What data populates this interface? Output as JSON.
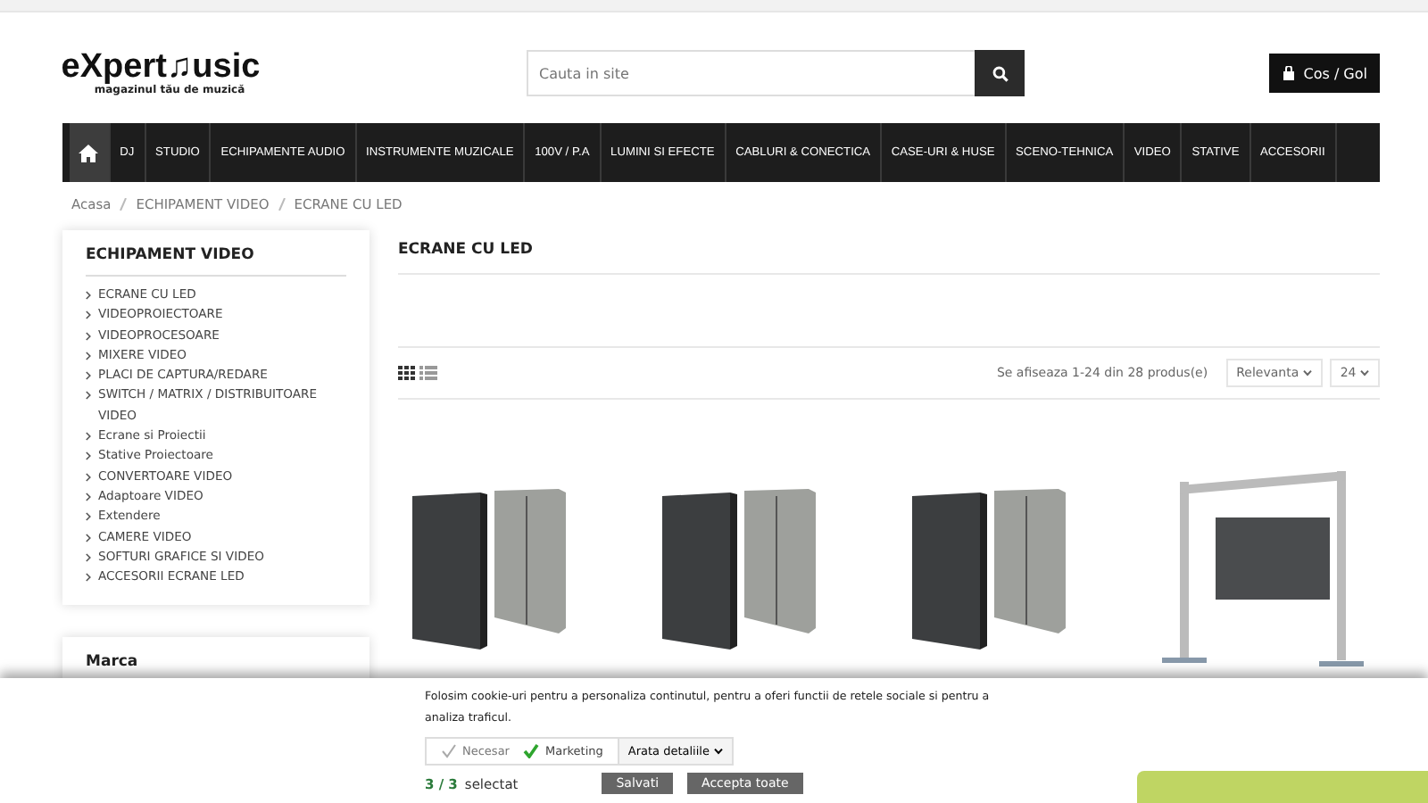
{
  "header": {
    "logo": {
      "name": "eXpert♫usic",
      "tagline": "magazinul tău de muzică"
    },
    "search": {
      "placeholder": "Cauta in site"
    },
    "cart": "Cos / Gol"
  },
  "nav": [
    {
      "kind": "home",
      "selected": true
    },
    {
      "kind": "link",
      "label": "DJ",
      "selected": false
    },
    {
      "kind": "link",
      "label": "STUDIO",
      "selected": false
    },
    {
      "kind": "link",
      "label": "ECHIPAMENTE AUDIO",
      "selected": false
    },
    {
      "kind": "link",
      "label": "INSTRUMENTE MUZICALE",
      "selected": false
    },
    {
      "kind": "link",
      "label": "100V / P.A",
      "selected": false
    },
    {
      "kind": "link",
      "label": "LUMINI SI EFECTE",
      "selected": false
    },
    {
      "kind": "link",
      "label": "CABLURI & CONECTICA",
      "selected": false
    },
    {
      "kind": "link",
      "label": "CASE-URI & HUSE",
      "selected": false
    },
    {
      "kind": "link",
      "label": "SCENO-TEHNICA",
      "selected": false
    },
    {
      "kind": "link",
      "label": "VIDEO",
      "selected": false
    },
    {
      "kind": "link",
      "label": "STATIVE",
      "selected": false
    },
    {
      "kind": "link",
      "label": "ACCESORII",
      "selected": false
    }
  ],
  "breadcrumb": [
    "Acasa",
    "ECHIPAMENT VIDEO",
    "ECRANE CU LED"
  ],
  "sidebar": {
    "title": "ECHIPAMENT VIDEO",
    "items": [
      "ECRANE CU LED",
      "VIDEOPROIECTOARE",
      "VIDEOPROCESOARE",
      "MIXERE VIDEO",
      "PLACI DE CAPTURA/REDARE",
      "SWITCH / MATRIX / DISTRIBUITOARE VIDEO",
      "Ecrane si Proiectii",
      "Stative Proiectoare",
      "CONVERTOARE VIDEO",
      "Adaptoare VIDEO",
      "Extendere",
      "CAMERE VIDEO",
      "SOFTURI GRAFICE SI VIDEO",
      "ACCESORII ECRANE LED"
    ],
    "second_title": "Marca"
  },
  "main": {
    "title": "ECRANE CU LED",
    "count": "Se afiseaza 1-24 din 28 produs(e)",
    "sort": "Relevanta",
    "per_page": "24",
    "view_modes": [
      {
        "kind": "grid",
        "selected": true
      },
      {
        "kind": "list",
        "selected": false
      }
    ],
    "products": [
      {
        "kind": "panel"
      },
      {
        "kind": "panel"
      },
      {
        "kind": "panel"
      },
      {
        "kind": "truss"
      }
    ]
  },
  "cookie": {
    "text": "Folosim cookie-uri pentru a personaliza continutul, pentru a oferi functii de retele sociale si pentru a analiza traficul.",
    "options": [
      {
        "label": "Necesar",
        "checked": true,
        "disabled": true
      },
      {
        "label": "Marketing",
        "checked": true,
        "disabled": false
      }
    ],
    "details": "Arata detaliile",
    "selected_count": "3 / 3",
    "selected_label": "selectat",
    "buttons": [
      "Salvati",
      "Accepta toate"
    ]
  }
}
